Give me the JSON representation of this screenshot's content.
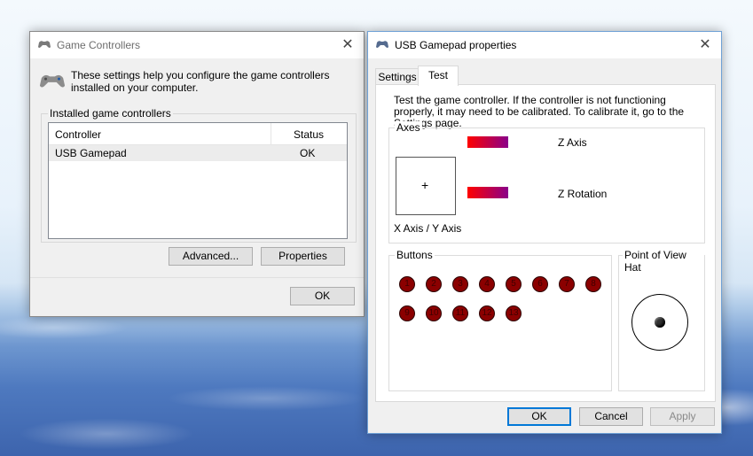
{
  "game_controllers": {
    "title": "Game Controllers",
    "description": "These settings help you configure the game controllers installed on your computer.",
    "group_label": "Installed game controllers",
    "columns": [
      "Controller",
      "Status"
    ],
    "rows": [
      {
        "name": "USB Gamepad",
        "status": "OK"
      }
    ],
    "advanced_button": "Advanced...",
    "properties_button": "Properties",
    "ok_button": "OK",
    "close_glyph": "✕"
  },
  "properties": {
    "title": "USB Gamepad  properties",
    "tabs": [
      "Settings",
      "Test"
    ],
    "active_tab": "Test",
    "instructions": "Test the game controller.  If the controller is not functioning properly, it may need to be calibrated.  To calibrate it, go to the Settings page.",
    "axes_label": "Axes",
    "xy_label": "X Axis / Y Axis",
    "crosshair": "+",
    "z_axis_label": "Z Axis",
    "z_rotation_label": "Z Rotation",
    "buttons_label": "Buttons",
    "button_numbers": [
      "1",
      "2",
      "3",
      "4",
      "5",
      "6",
      "7",
      "8",
      "9",
      "10",
      "11",
      "12",
      "13"
    ],
    "pov_label": "Point of View Hat",
    "ok_button": "OK",
    "cancel_button": "Cancel",
    "apply_button": "Apply",
    "close_glyph": "✕"
  },
  "colors": {
    "accent": "#0078d7",
    "button_led": "#8b0000",
    "axis_bar_start": "#ff0000",
    "axis_bar_end": "#8a008a"
  }
}
